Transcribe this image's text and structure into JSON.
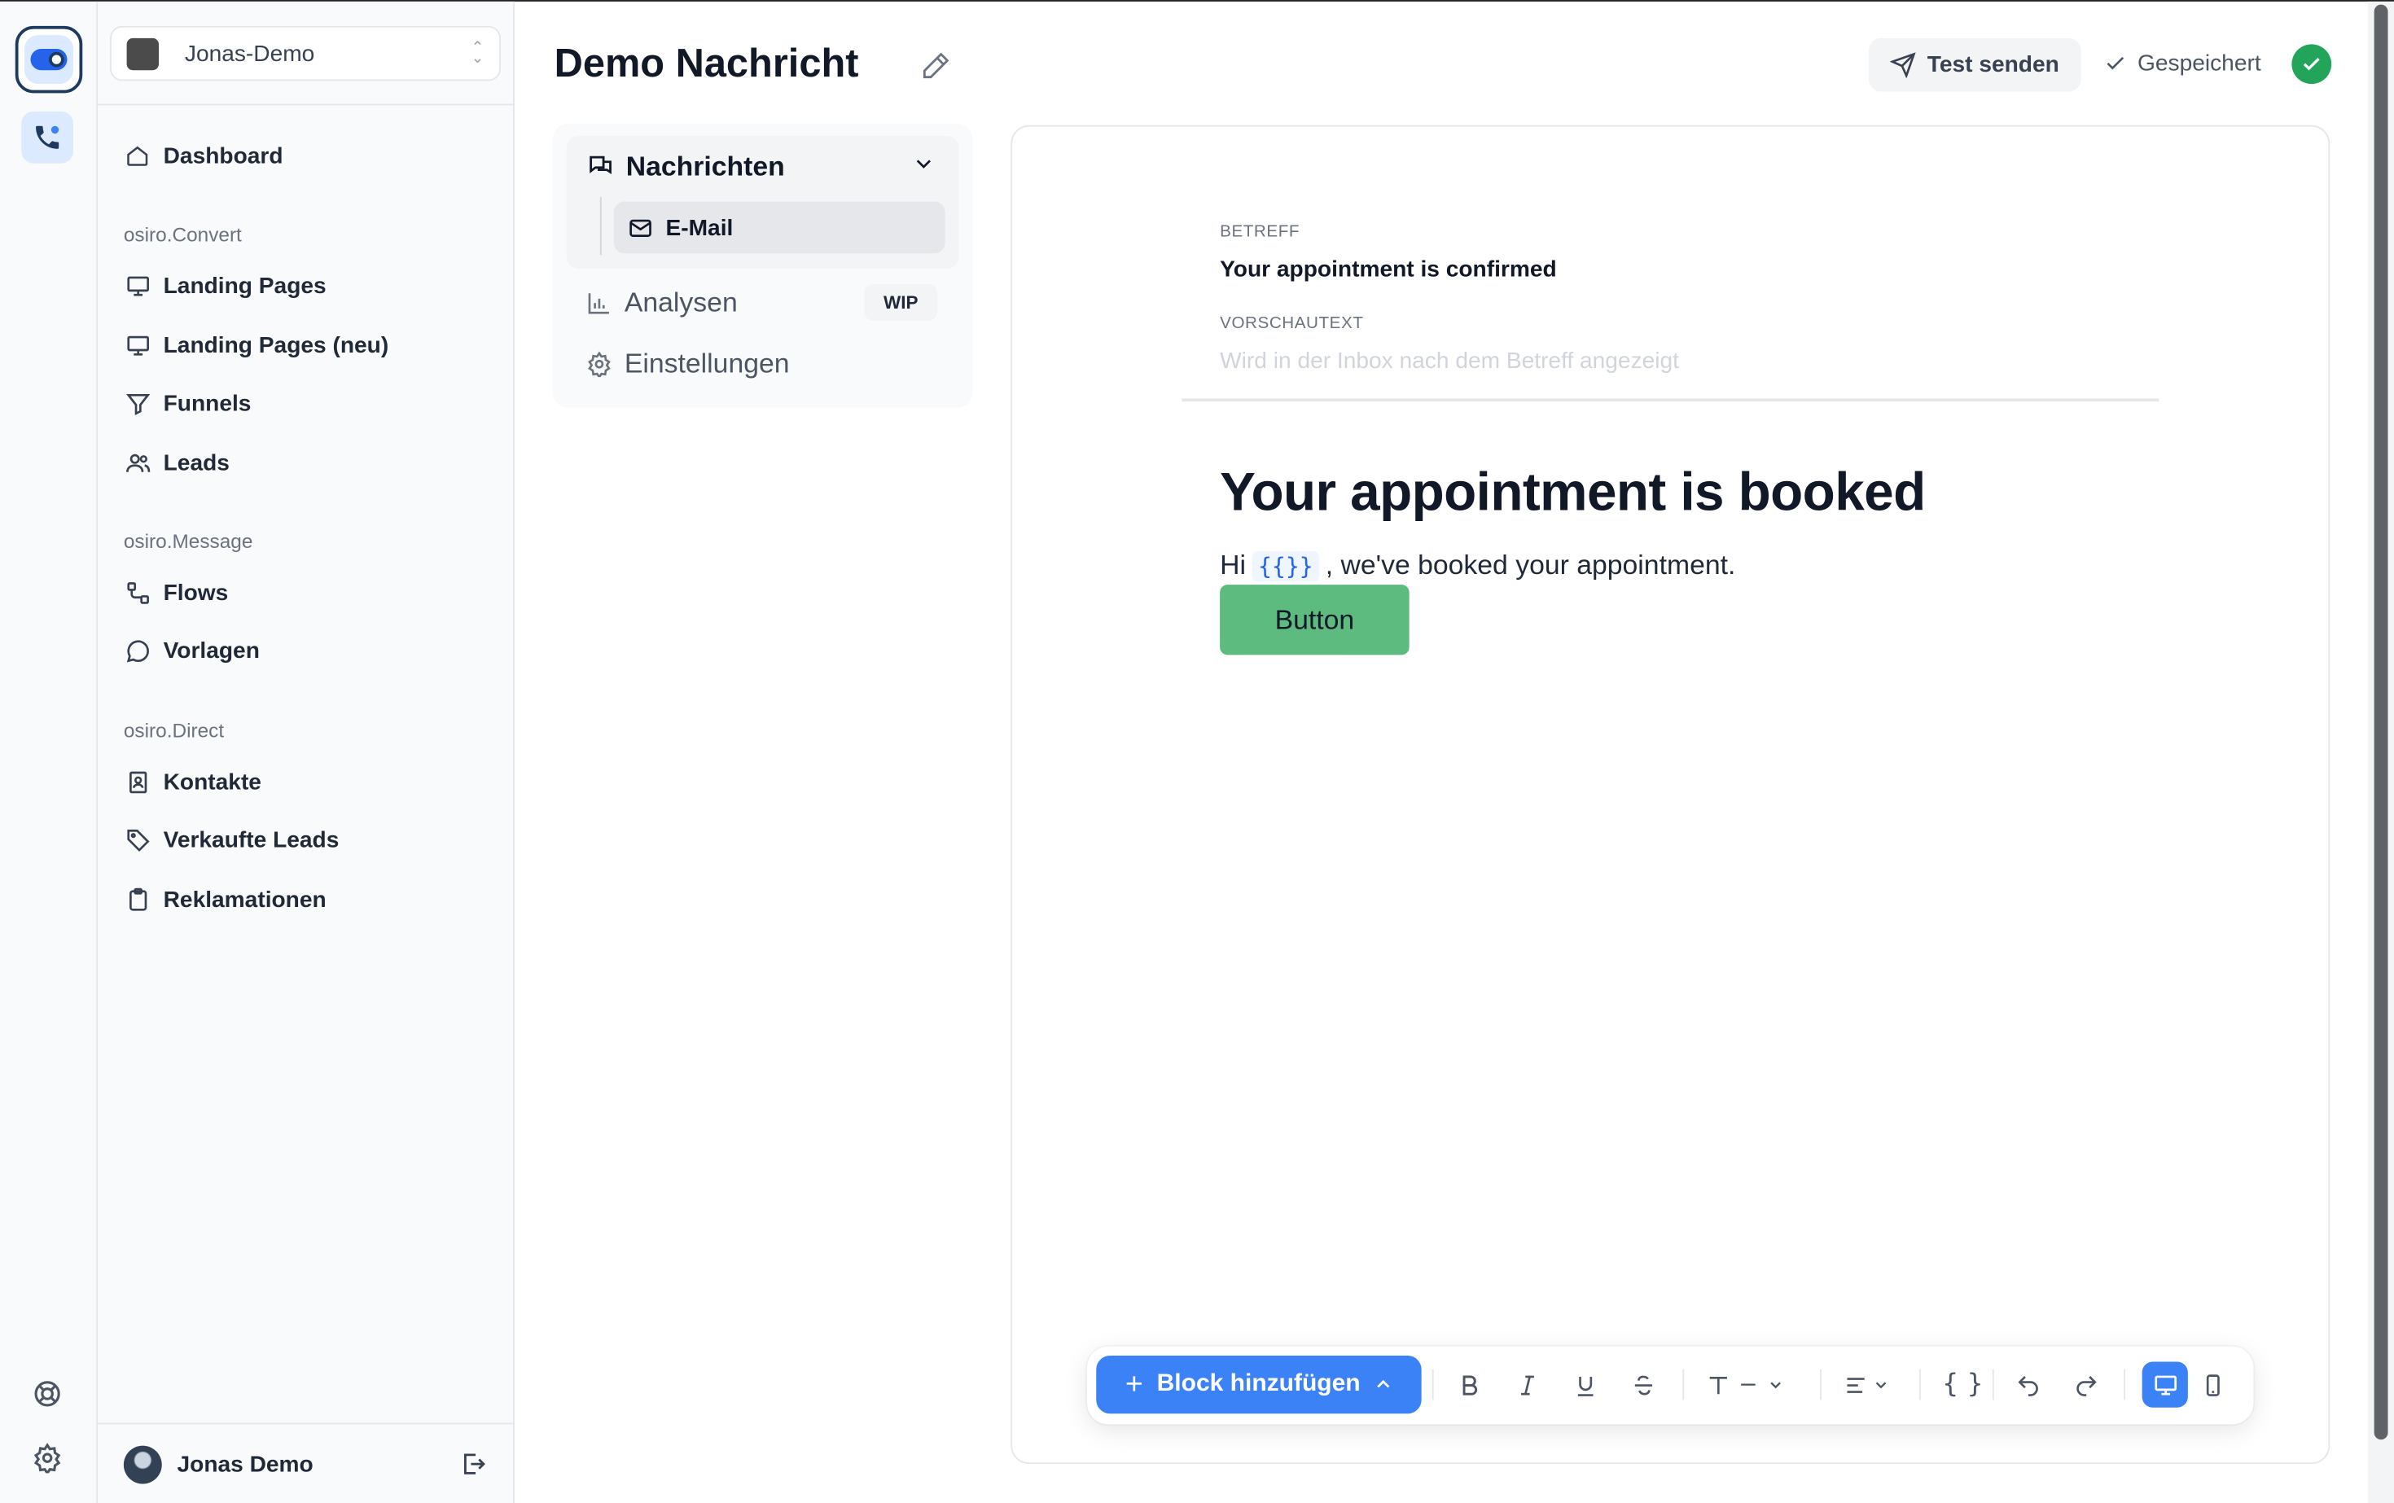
{
  "workspace": {
    "name": "Jonas-Demo"
  },
  "sidebar": {
    "dashboard": "Dashboard",
    "groups": [
      {
        "title": "osiro.Convert",
        "items": [
          "Landing Pages",
          "Landing Pages (neu)",
          "Funnels",
          "Leads"
        ]
      },
      {
        "title": "osiro.Message",
        "items": [
          "Flows",
          "Vorlagen"
        ]
      },
      {
        "title": "osiro.Direct",
        "items": [
          "Kontakte",
          "Verkaufte Leads",
          "Reklamationen"
        ]
      }
    ],
    "user": {
      "name": "Jonas Demo"
    }
  },
  "header": {
    "title": "Demo Nachricht",
    "test_send": "Test senden",
    "saved": "Gespeichert"
  },
  "subnav": {
    "messages": "Nachrichten",
    "email": "E-Mail",
    "analyses": "Analysen",
    "analyses_badge": "WIP",
    "settings": "Einstellungen"
  },
  "editor": {
    "subject_label": "BETREFF",
    "subject": "Your appointment is confirmed",
    "preview_label": "VORSCHAUTEXT",
    "preview_placeholder": "Wird in der Inbox nach dem Betreff angezeigt",
    "heading": "Your appointment is booked",
    "para_hi": "Hi",
    "para_var": "{{}}",
    "para_rest": ", we've booked your appointment.",
    "button": "Button"
  },
  "toolbar": {
    "add_block": "Block hinzufügen",
    "variable": "{ }",
    "device": "desktop"
  },
  "colors": {
    "accent": "#3b82f6",
    "success": "#22a55a",
    "email_button": "#5dbb7f"
  }
}
